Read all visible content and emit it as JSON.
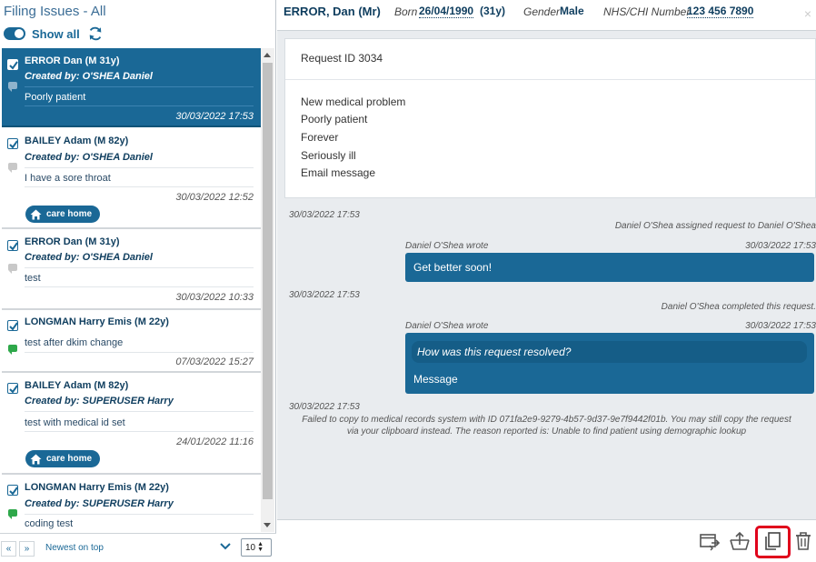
{
  "left_panel": {
    "title": "Filing Issues - All",
    "show_all_label": "Show all",
    "items": [
      {
        "name": "ERROR Dan (M 31y)",
        "created_by": "Created by: O'SHEA Daniel",
        "text": "Poorly patient",
        "date": "30/03/2022 17:53",
        "tag": "",
        "bubble": "grey",
        "selected": true
      },
      {
        "name": "BAILEY Adam (M 82y)",
        "created_by": "Created by: O'SHEA Daniel",
        "text": "I have a sore throat",
        "date": "30/03/2022 12:52",
        "tag": "care home",
        "bubble": "grey",
        "selected": false
      },
      {
        "name": "ERROR Dan (M 31y)",
        "created_by": "Created by: O'SHEA Daniel",
        "text": "test",
        "date": "30/03/2022 10:33",
        "tag": "",
        "bubble": "grey",
        "selected": false
      },
      {
        "name": "LONGMAN Harry Emis (M 22y)",
        "created_by": "",
        "text": "test after dkim change",
        "date": "07/03/2022 15:27",
        "tag": "",
        "bubble": "green",
        "selected": false
      },
      {
        "name": "BAILEY Adam (M 82y)",
        "created_by": "Created by: SUPERUSER Harry",
        "text": "test with medical id set",
        "date": "24/01/2022 11:16",
        "tag": "care home",
        "bubble": "none",
        "selected": false
      },
      {
        "name": "LONGMAN Harry Emis (M 22y)",
        "created_by": "Created by: SUPERUSER Harry",
        "text": "coding test",
        "date": "",
        "tag": "",
        "bubble": "green",
        "selected": false
      }
    ],
    "footer": {
      "prev": "«",
      "next": "»",
      "sort": "Newest on top",
      "page_size": "10"
    }
  },
  "header": {
    "name": "ERROR, Dan (Mr)",
    "born_label": "Born",
    "born_value": "26/04/1990",
    "age": "(31y)",
    "gender_label": "Gender",
    "gender_value": "Male",
    "nhs_label": "NHS/CHI Number",
    "nhs_value": "123 456 7890",
    "close": "×"
  },
  "request": {
    "title": "Request ID 3034",
    "lines": [
      "New medical problem",
      "Poorly patient",
      "Forever",
      "Seriously ill",
      "Email message"
    ]
  },
  "timeline": {
    "ts1": "30/03/2022 17:53",
    "event1": "Daniel O'Shea assigned request to Daniel O'Shea",
    "wrote1": "Daniel O'Shea wrote",
    "wrote1_date": "30/03/2022 17:53",
    "msg1": "Get better soon!",
    "ts2": "30/03/2022 17:53",
    "event2": "Daniel O'Shea completed this request.",
    "wrote2": "Daniel O'Shea wrote",
    "wrote2_date": "30/03/2022 17:53",
    "msg2_question": "How was this request resolved?",
    "msg2_text": "Message",
    "ts3": "30/03/2022 17:53",
    "fail_line1": "Failed to copy to medical records system with ID 071fa2e9-9279-4b57-9d37-9e7f9442f01b. You may still copy the request",
    "fail_line2": "via your clipboard instead. The reason reported is: Unable to find patient using demographic lookup"
  },
  "colors": {
    "accent": "#1a6896",
    "highlight": "#e0001b",
    "green": "#2ea84a"
  }
}
